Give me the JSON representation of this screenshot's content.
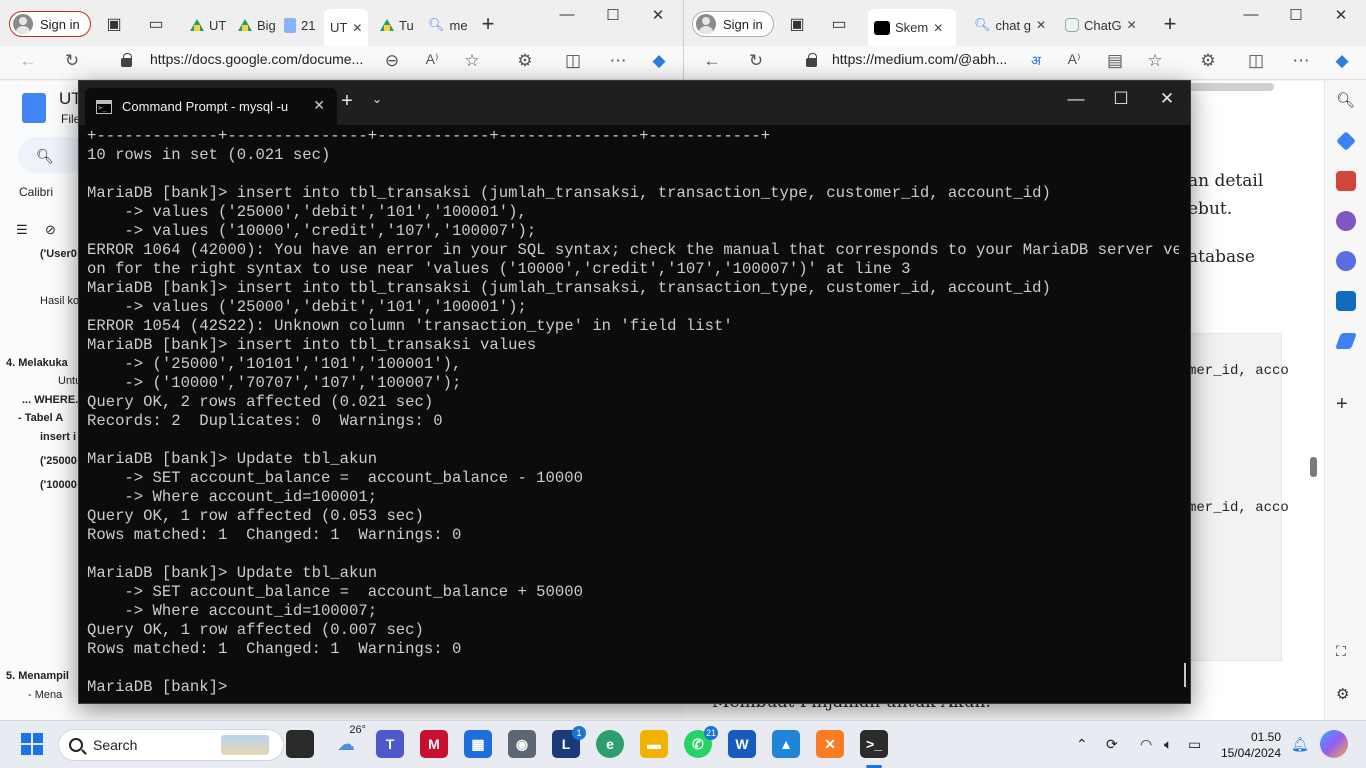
{
  "left_browser": {
    "sign_in": "Sign in",
    "tabs": [
      {
        "label": "UT"
      },
      {
        "label": "Big"
      },
      {
        "label": "21"
      },
      {
        "label": "UT"
      },
      {
        "label": "Tu"
      },
      {
        "label": "me"
      }
    ],
    "url": "https://docs.google.com/docume...",
    "doc": {
      "title": "UT",
      "menu": "File",
      "font": "Calibri",
      "lines": [
        "('User0",
        "Hasil ko",
        "4.  Melakuka",
        "Untu",
        "... WHERE.",
        "-    Tabel A",
        "insert i",
        "('25000",
        "('10000",
        "5.  Menampil",
        "-    Mena"
      ]
    }
  },
  "right_browser": {
    "sign_in": "Sign in",
    "tabs": [
      {
        "label": "Skem"
      },
      {
        "label": "chat g"
      },
      {
        "label": "ChatG"
      }
    ],
    "url": "https://medium.com/@abh...",
    "article": {
      "text1": "an detail",
      "text2": "ebut.",
      "text3": "atabase",
      "code1": "mer_id, acco",
      "code2": "mer_id, acco",
      "bottom": "Membuat Pinjaman untuk Akun."
    }
  },
  "terminal": {
    "title": "Command Prompt - mysql  -u",
    "lines": [
      "+-------------+---------------+------------+---------------+------------+",
      "10 rows in set (0.021 sec)",
      "",
      "MariaDB [bank]> insert into tbl_transaksi (jumlah_transaksi, transaction_type, customer_id, account_id)",
      "    -> values ('25000','debit','101','100001'),",
      "    -> values ('10000','credit','107','100007');",
      "ERROR 1064 (42000): You have an error in your SQL syntax; check the manual that corresponds to your MariaDB server versi",
      "on for the right syntax to use near 'values ('10000','credit','107','100007')' at line 3",
      "MariaDB [bank]> insert into tbl_transaksi (jumlah_transaksi, transaction_type, customer_id, account_id)",
      "    -> values ('25000','debit','101','100001');",
      "ERROR 1054 (42S22): Unknown column 'transaction_type' in 'field list'",
      "MariaDB [bank]> insert into tbl_transaksi values",
      "    -> ('25000','10101','101','100001'),",
      "    -> ('10000','70707','107','100007');",
      "Query OK, 2 rows affected (0.021 sec)",
      "Records: 2  Duplicates: 0  Warnings: 0",
      "",
      "MariaDB [bank]> Update tbl_akun",
      "    -> SET account_balance =  account_balance - 10000",
      "    -> Where account_id=100001;",
      "Query OK, 1 row affected (0.053 sec)",
      "Rows matched: 1  Changed: 1  Warnings: 0",
      "",
      "MariaDB [bank]> Update tbl_akun",
      "    -> SET account_balance =  account_balance + 50000",
      "    -> Where account_id=100007;",
      "Query OK, 1 row affected (0.007 sec)",
      "Rows matched: 1  Changed: 1  Warnings: 0",
      "",
      "MariaDB [bank]> "
    ]
  },
  "taskbar": {
    "search_label": "Search",
    "weather": "26°",
    "outlook_badge": "1",
    "whatsapp_badge": "21",
    "time": "01.50",
    "date": "15/04/2024"
  }
}
